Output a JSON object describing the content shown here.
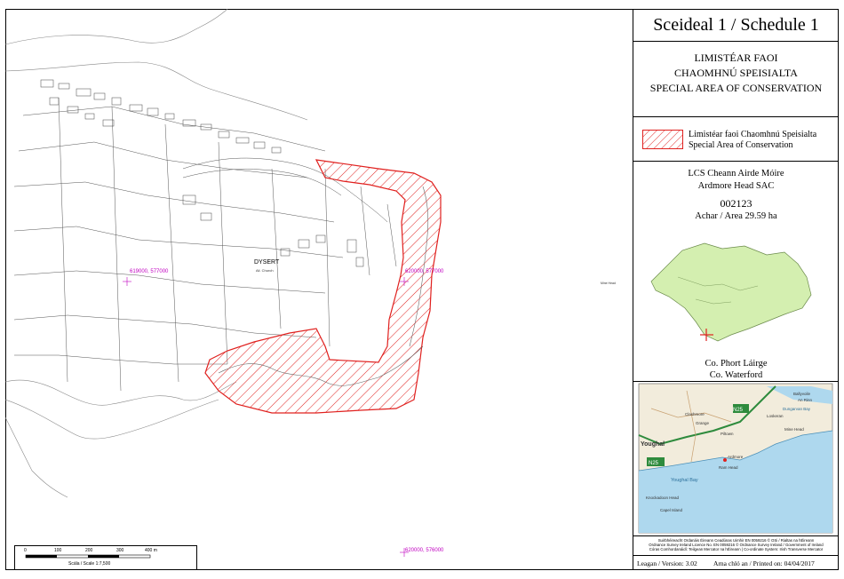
{
  "panel": {
    "title": "Sceideal 1 / Schedule 1",
    "subtitle_line1": "LIMISTÉAR FAOI",
    "subtitle_line2": "CHAOMHNÚ SPEISIALTA",
    "subtitle_line3": "SPECIAL AREA OF CONSERVATION",
    "legend_line1": "Limistéar faoi Chaomhnú Speisialta",
    "legend_line2": "Special Area of Conservation",
    "site_name_ga": "LCS Cheann Airde Móire",
    "site_name_en": "Ardmore Head SAC",
    "site_code": "002123",
    "area": "Achar / Area 29.59 ha",
    "county_ga": "Co. Phort Láirge",
    "county_en": "Co. Waterford",
    "credits_line1": "Suirbhéireacht Ordanáis Éireann Ceadúnas Uimhir EN 0059216 © OSi / Rialtas na hÉireann",
    "credits_line2": "Ordnance Survey Ireland Licence No. EN 0059216 © Ordnance Survey Ireland / Government of Ireland",
    "credits_line3": "Córas Comhordanáidí: Teilgean Mercator na hÉireann | Co-ordinate System: Irish Transverse Mercator",
    "version": "Leagan / Version: 3.02",
    "printed": "Arna chló an / Printed on: 04/04/2017"
  },
  "map": {
    "coords": [
      "619000, 577000",
      "620000, 577000",
      "576000",
      "620000, 576000"
    ],
    "place_label": "DYSERT",
    "place_sub": "Ail. Church",
    "scale_ticks": [
      "0",
      "100",
      "200",
      "300",
      "400 m"
    ],
    "scale_label": "Scála / Scale 1:7,500",
    "tiny_label": "Mine Head"
  },
  "locator": {
    "places": [
      "Youghal",
      "Clashmore",
      "Loskeran",
      "Mine Head",
      "Ardmore",
      "Ram Head",
      "Youghal Bay",
      "Knockadoon Head",
      "Capel Island",
      "Ballyvoile",
      "An Rinn",
      "Dungarvan Bay",
      "Grange",
      "Piltown"
    ],
    "roads": [
      "N25",
      "N25"
    ]
  },
  "colors": {
    "sac": "#e0201e",
    "map_line": "#555555",
    "coord": "#c000c0",
    "county_fill": "#d4efb0",
    "sea": "#aed8ee"
  }
}
